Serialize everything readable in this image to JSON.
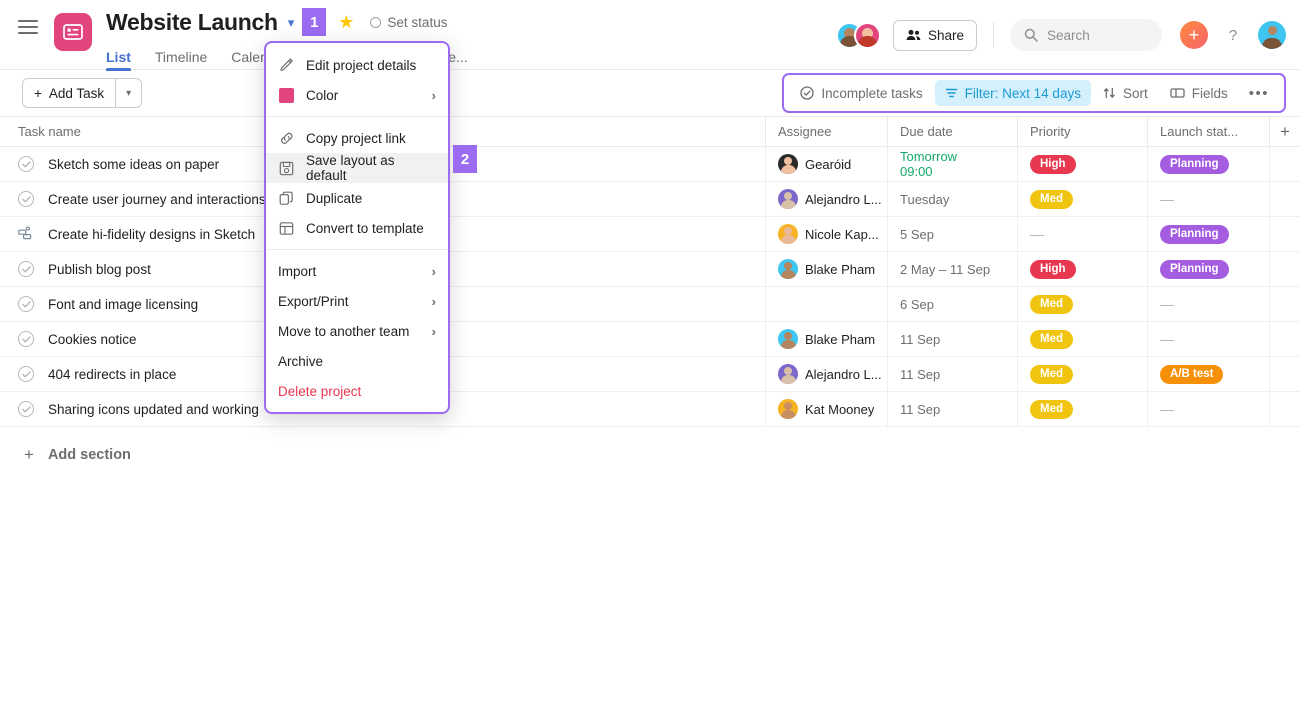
{
  "header": {
    "project_title": "Website Launch",
    "annotation_badge_1": "1",
    "set_status": "Set status",
    "share_label": "Share",
    "search_placeholder": "Search",
    "plus_label": "+",
    "help_label": "?",
    "tabs": [
      {
        "label": "List",
        "active": true
      },
      {
        "label": "Timeline",
        "active": false
      },
      {
        "label": "Calendar",
        "active": false
      },
      {
        "label": "More...",
        "active": false
      }
    ]
  },
  "toolbar": {
    "add_task_label": "Add Task",
    "incomplete_tasks_label": "Incomplete tasks",
    "filter_label": "Filter: Next 14 days",
    "sort_label": "Sort",
    "fields_label": "Fields",
    "more_label": "•••",
    "annotation_badge_2": "2"
  },
  "menu": {
    "items": [
      {
        "label": "Edit project details",
        "icon": "pencil-icon",
        "submenu": false
      },
      {
        "label": "Color",
        "icon": "color-swatch-icon",
        "submenu": true
      },
      {
        "sep": true
      },
      {
        "label": "Copy project link",
        "icon": "link-icon",
        "submenu": false
      },
      {
        "label": "Save layout as default",
        "icon": "save-icon",
        "submenu": false,
        "highlighted": true
      },
      {
        "label": "Duplicate",
        "icon": "duplicate-icon",
        "submenu": false
      },
      {
        "label": "Convert to template",
        "icon": "template-icon",
        "submenu": false
      },
      {
        "sep": true
      },
      {
        "label": "Import",
        "icon": null,
        "submenu": true
      },
      {
        "label": "Export/Print",
        "icon": null,
        "submenu": true
      },
      {
        "label": "Move to another team",
        "icon": null,
        "submenu": true
      },
      {
        "label": "Archive",
        "icon": null,
        "submenu": false
      },
      {
        "label": "Delete project",
        "icon": null,
        "submenu": false,
        "danger": true
      }
    ]
  },
  "table": {
    "columns": [
      "Task name",
      "Assignee",
      "Due date",
      "Priority",
      "Launch stat..."
    ],
    "add_column_label": "+",
    "rows": [
      {
        "task": "Sketch some ideas on paper",
        "icon": "check-circle-icon",
        "assignee": "Gearóid",
        "avatar_skin": "#f0c0a0",
        "avatar_bg": "#2a2a2a",
        "due": "Tomorrow",
        "due2": "09:00",
        "due_green": true,
        "priority": "High",
        "priority_color": "#e8384f",
        "launch": "Planning",
        "launch_color": "#a45ce0"
      },
      {
        "task": "Create user journey and interactions",
        "icon": "check-circle-icon",
        "assignee": "Alejandro L...",
        "avatar_skin": "#d9c0a8",
        "avatar_bg": "#7b68c9",
        "due": "Tuesday",
        "due2": "",
        "due_green": false,
        "priority": "Med",
        "priority_color": "#f1c40f",
        "launch": "—",
        "launch_color": null
      },
      {
        "task": "Create hi-fidelity designs in Sketch",
        "icon": "subtask-icon",
        "assignee": "Nicole Kap...",
        "avatar_skin": "#e8b898",
        "avatar_bg": "#f5b324",
        "due": "5 Sep",
        "due2": "",
        "due_green": false,
        "priority": "—",
        "priority_color": null,
        "launch": "Planning",
        "launch_color": "#a45ce0"
      },
      {
        "task": "Publish blog post",
        "icon": "check-circle-icon",
        "assignee": "Blake Pham",
        "avatar_skin": "#b58560",
        "avatar_bg": "#3ec6f0",
        "due": "2 May – 11 Sep",
        "due2": "",
        "due_green": false,
        "priority": "High",
        "priority_color": "#e8384f",
        "launch": "Planning",
        "launch_color": "#a45ce0"
      },
      {
        "task": "Font and image licensing",
        "icon": "check-circle-icon",
        "assignee": "",
        "avatar_skin": null,
        "avatar_bg": null,
        "due": "6 Sep",
        "due2": "",
        "due_green": false,
        "priority": "Med",
        "priority_color": "#f1c40f",
        "launch": "—",
        "launch_color": null
      },
      {
        "task": "Cookies notice",
        "icon": "check-circle-icon",
        "assignee": "Blake Pham",
        "avatar_skin": "#b58560",
        "avatar_bg": "#3ec6f0",
        "due": "11 Sep",
        "due2": "",
        "due_green": false,
        "priority": "Med",
        "priority_color": "#f1c40f",
        "launch": "—",
        "launch_color": null
      },
      {
        "task": "404 redirects in place",
        "icon": "check-circle-icon",
        "assignee": "Alejandro L...",
        "avatar_skin": "#d9c0a8",
        "avatar_bg": "#7b68c9",
        "due": "11 Sep",
        "due2": "",
        "due_green": false,
        "priority": "Med",
        "priority_color": "#f1c40f",
        "launch": "A/B test",
        "launch_color": "#f79009"
      },
      {
        "task": "Sharing icons updated and working",
        "icon": "check-circle-icon",
        "assignee": "Kat Mooney",
        "avatar_skin": "#c98f62",
        "avatar_bg": "#f5b324",
        "due": "11 Sep",
        "due2": "",
        "due_green": false,
        "priority": "Med",
        "priority_color": "#f1c40f",
        "launch": "—",
        "launch_color": null
      }
    ],
    "add_section_label": "Add section"
  },
  "colors": {
    "accent_purple": "#9b6cf2",
    "brand_pink": "#e2457e",
    "link_blue": "#4573d2",
    "filter_blue": "#1d9bd1",
    "green": "#14aa6a",
    "danger_red": "#e8384f"
  }
}
